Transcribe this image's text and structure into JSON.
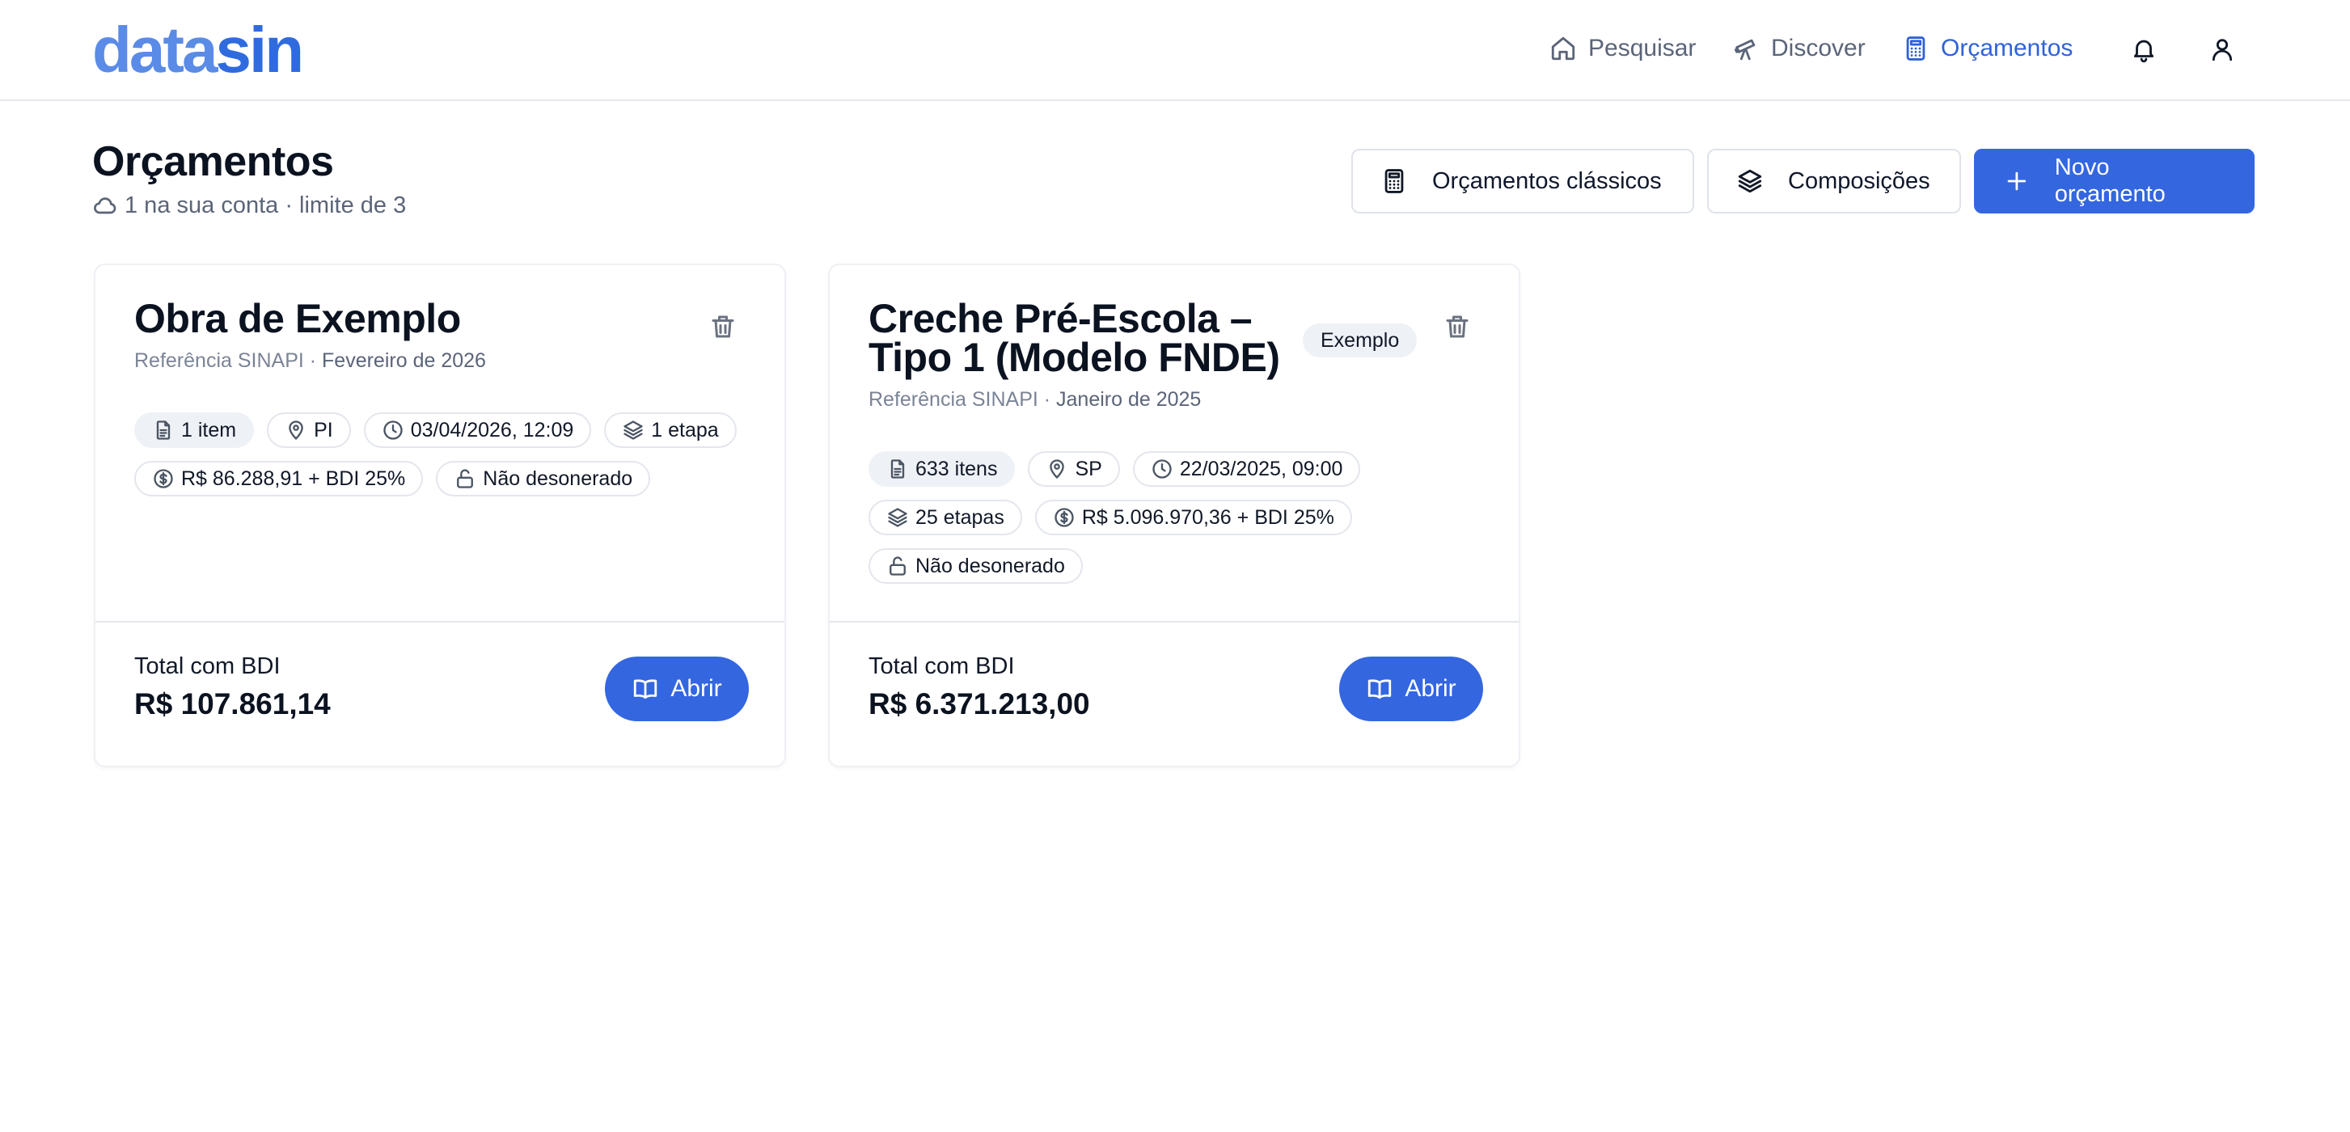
{
  "app": {
    "logo_part1": "data",
    "logo_part2": "sin",
    "brand_color": "#2f6bde"
  },
  "nav": {
    "items": [
      {
        "label": "Pesquisar",
        "icon": "home-icon",
        "active": false
      },
      {
        "label": "Discover",
        "icon": "telescope-icon",
        "active": false
      },
      {
        "label": "Orçamentos",
        "icon": "calculator-icon",
        "active": true
      }
    ],
    "actions": [
      "bell-icon",
      "user-icon"
    ]
  },
  "page": {
    "title": "Orçamentos",
    "subtitle": "1 na sua conta · limite de 3",
    "subtitle_icon": "cloud-icon"
  },
  "toolbar": {
    "classic_label": "Orçamentos clássicos",
    "compositions_label": "Composições",
    "new_label": "Novo orçamento",
    "accent_color": "#3466e0"
  },
  "cards": [
    {
      "title": "Obra de Exemplo",
      "ref_prefix": "Referência SINAPI · ",
      "ref_date": "Fevereiro de 2026",
      "badge": "",
      "chips": [
        {
          "icon": "file-icon",
          "text": "1 item",
          "filled": true
        },
        {
          "icon": "map-pin-icon",
          "text": "PI",
          "filled": false
        },
        {
          "icon": "clock-icon",
          "text": "03/04/2026, 12:09",
          "filled": false
        },
        {
          "icon": "layers-icon",
          "text": "1 etapa",
          "filled": false
        },
        {
          "icon": "dollar-circle-icon",
          "text": "R$ 86.288,91 + BDI 25%",
          "filled": false
        },
        {
          "icon": "unlock-icon",
          "text": "Não desonerado",
          "filled": false
        }
      ],
      "total_label": "Total com BDI",
      "total_value": "R$ 107.861,14",
      "open_label": "Abrir"
    },
    {
      "title_line1": "Creche Pré-Escola –",
      "title_line2": "Tipo 1 (Modelo FNDE)",
      "ref_prefix": "Referência SINAPI · ",
      "ref_date": "Janeiro de 2025",
      "badge": "Exemplo",
      "chips": [
        {
          "icon": "file-icon",
          "text": "633 itens",
          "filled": true
        },
        {
          "icon": "map-pin-icon",
          "text": "SP",
          "filled": false
        },
        {
          "icon": "clock-icon",
          "text": "22/03/2025, 09:00",
          "filled": false
        },
        {
          "icon": "layers-icon",
          "text": "25 etapas",
          "filled": false
        },
        {
          "icon": "dollar-circle-icon",
          "text": "R$ 5.096.970,36 + BDI 25%",
          "filled": false
        },
        {
          "icon": "unlock-icon",
          "text": "Não desonerado",
          "filled": false
        }
      ],
      "total_label": "Total com BDI",
      "total_value": "R$ 6.371.213,00",
      "open_label": "Abrir"
    }
  ]
}
